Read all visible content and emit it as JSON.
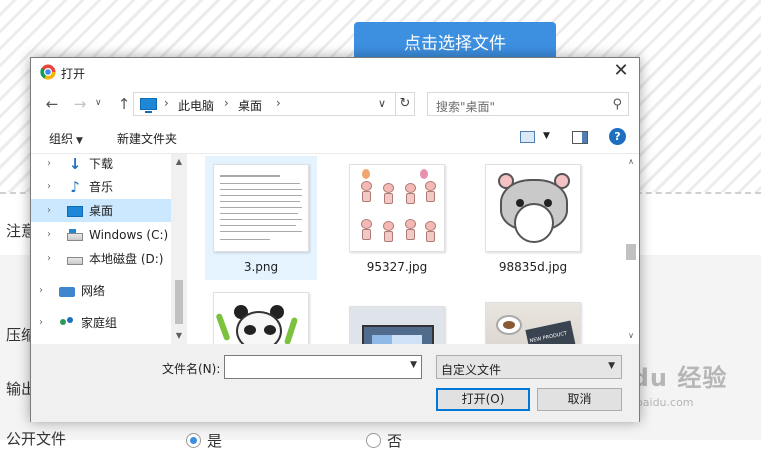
{
  "background": {
    "upload_button": "点击选择文件",
    "label_notice": "注意",
    "label_compress": "压缩",
    "label_output": "输出",
    "label_public": "公开文件",
    "radio_yes": "是",
    "radio_no": "否",
    "watermark": "Baidu 经验",
    "watermark_sub": "jingyan.baidu.com"
  },
  "dialog": {
    "title": "打开",
    "close": "✕",
    "nav": {
      "back": "←",
      "forward": "→",
      "up": "↑",
      "refresh": "↻",
      "dropdown": "∨"
    },
    "breadcrumb": [
      "此电脑",
      "桌面"
    ],
    "search_placeholder": "搜索\"桌面\"",
    "toolbar": {
      "organize": "组织",
      "new_folder": "新建文件夹",
      "help": "?"
    },
    "tree": [
      {
        "label": "下载",
        "icon": "download-icon"
      },
      {
        "label": "音乐",
        "icon": "music-icon"
      },
      {
        "label": "桌面",
        "icon": "desktop-icon",
        "selected": true
      },
      {
        "label": "Windows (C:)",
        "icon": "drive-icon"
      },
      {
        "label": "本地磁盘 (D:)",
        "icon": "drive-icon"
      },
      {
        "label": "网络",
        "icon": "network-icon"
      },
      {
        "label": "家庭组",
        "icon": "homegroup-icon"
      }
    ],
    "files": [
      {
        "name": "3.png",
        "selected": true
      },
      {
        "name": "95327.jpg"
      },
      {
        "name": "98835d.jpg"
      },
      {
        "name": ""
      },
      {
        "name": ""
      },
      {
        "name": ""
      }
    ],
    "thumb_text": "NEW PRODUCT",
    "filename_label": "文件名(N):",
    "filename_value": "",
    "filetype_value": "自定义文件",
    "open_button": "打开(O)",
    "cancel_button": "取消"
  },
  "colors": {
    "accent": "#0078d7",
    "upload_button": "#3d8fe0",
    "selection": "#cce8ff"
  }
}
